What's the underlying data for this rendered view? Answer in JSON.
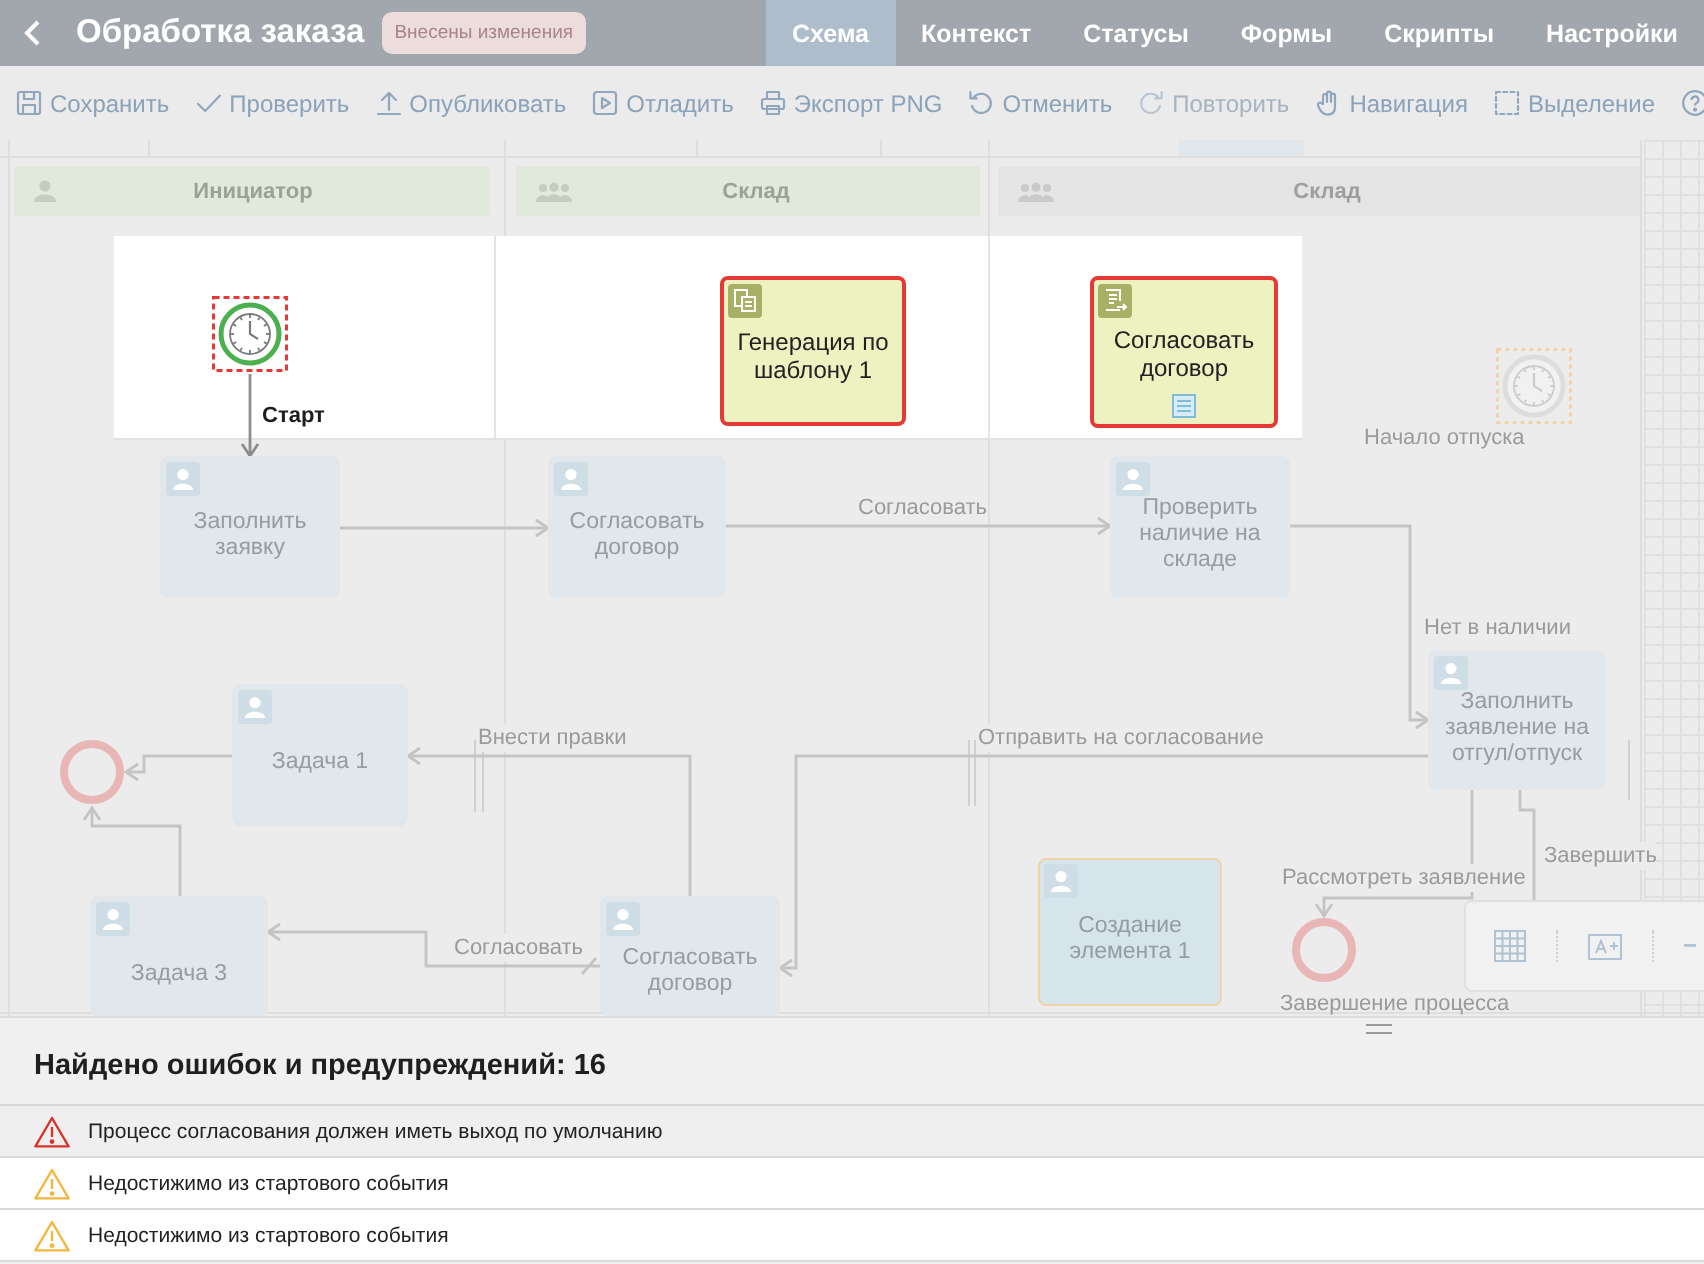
{
  "header": {
    "title": "Обработка заказа",
    "badge": "Внесены изменения"
  },
  "tabs": [
    {
      "label": "Схема",
      "selected": true
    },
    {
      "label": "Контекст",
      "selected": false
    },
    {
      "label": "Статусы",
      "selected": false
    },
    {
      "label": "Формы",
      "selected": false
    },
    {
      "label": "Скрипты",
      "selected": false
    },
    {
      "label": "Настройки",
      "selected": false
    }
  ],
  "toolbar": [
    {
      "kind": "save",
      "label": "Сохранить",
      "disabled": false
    },
    {
      "kind": "check",
      "label": "Проверить",
      "disabled": false
    },
    {
      "kind": "publish",
      "label": "Опубликовать",
      "disabled": false
    },
    {
      "kind": "debug",
      "label": "Отладить",
      "disabled": false
    },
    {
      "kind": "export",
      "label": "Экспорт PNG",
      "disabled": false
    },
    {
      "kind": "undo",
      "label": "Отменить",
      "disabled": false
    },
    {
      "kind": "redo",
      "label": "Повторить",
      "disabled": true
    },
    {
      "kind": "pan",
      "label": "Навигация",
      "disabled": false
    },
    {
      "kind": "select",
      "label": "Выделение",
      "disabled": false
    }
  ],
  "diagram": {
    "lanes": [
      {
        "label": "Инициатор",
        "kind": "person",
        "highlighted": true
      },
      {
        "label": "Склад",
        "kind": "group",
        "highlighted": true
      },
      {
        "label": "Склад",
        "kind": "group",
        "highlighted": false
      }
    ],
    "nodes": [
      {
        "kind": "timer-start",
        "label": "Старт",
        "error": true,
        "warning": false,
        "dimmed": false
      },
      {
        "kind": "template",
        "label": "Генерация по шаблону 1",
        "error": true,
        "warning": false,
        "dimmed": false
      },
      {
        "kind": "approval",
        "label": "Согласовать договор",
        "error": true,
        "warning": false,
        "dimmed": false
      },
      {
        "kind": "timer-start",
        "label": "Начало отпуска",
        "error": false,
        "warning": true,
        "dimmed": true
      },
      {
        "kind": "user",
        "label": "Заполнить заявку",
        "error": false,
        "warning": false,
        "dimmed": true
      },
      {
        "kind": "user",
        "label": "Согласовать договор",
        "error": false,
        "warning": false,
        "dimmed": true
      },
      {
        "kind": "user",
        "label": "Проверить наличие на складе",
        "error": false,
        "warning": false,
        "dimmed": true
      },
      {
        "kind": "end",
        "error": false,
        "warning": false,
        "dimmed": true
      },
      {
        "kind": "user",
        "label": "Задача 1",
        "error": false,
        "warning": false,
        "dimmed": true
      },
      {
        "kind": "user",
        "label": "Заполнить заявление на отгул/отпуск",
        "error": false,
        "warning": false,
        "dimmed": true
      },
      {
        "kind": "user",
        "label": "Задача 3",
        "error": false,
        "warning": false,
        "dimmed": true
      },
      {
        "kind": "user",
        "label": "Согласовать договор",
        "error": false,
        "warning": false,
        "dimmed": true
      },
      {
        "kind": "user",
        "label": "Создание элемента 1",
        "error": false,
        "warning": true,
        "dimmed": true
      },
      {
        "kind": "end",
        "label": "Завершение процесса",
        "error": false,
        "warning": false,
        "dimmed": true
      }
    ],
    "edges": [
      {
        "label": "Согласовать"
      },
      {
        "label": "Нет в наличии"
      },
      {
        "label": "Внести правки"
      },
      {
        "label": "Отправить на согласование"
      },
      {
        "label": "Рассмотреть заявление"
      },
      {
        "label": "Завершить"
      },
      {
        "label": "Согласовать"
      }
    ]
  },
  "problems": {
    "title": "Найдено ошибок и предупреждений: 16",
    "items": [
      {
        "kind": "error",
        "text": "Процесс согласования должен иметь выход по умолчанию",
        "selected": true
      },
      {
        "kind": "warning",
        "text": "Недостижимо из стартового события",
        "selected": false
      },
      {
        "kind": "warning",
        "text": "Недостижимо из стартового события",
        "selected": false
      }
    ]
  }
}
